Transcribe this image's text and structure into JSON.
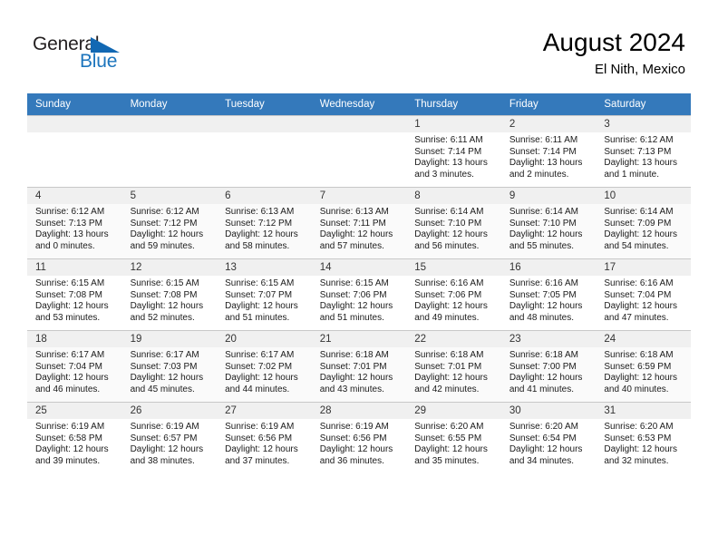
{
  "brand": {
    "line1": "General",
    "line2": "Blue",
    "mark": "triangle-logo"
  },
  "header": {
    "title": "August 2024",
    "subtitle": "El Nith, Mexico"
  },
  "weekdays": [
    "Sunday",
    "Monday",
    "Tuesday",
    "Wednesday",
    "Thursday",
    "Friday",
    "Saturday"
  ],
  "colors": {
    "header_band": "#3479bb",
    "brand_blue": "#1d75bd",
    "daynum_band": "#f0f0f0",
    "row_divider": "#c8c8c8"
  },
  "weeks": [
    [
      {
        "day": "",
        "sunrise": "",
        "sunset": "",
        "daylight1": "",
        "daylight2": ""
      },
      {
        "day": "",
        "sunrise": "",
        "sunset": "",
        "daylight1": "",
        "daylight2": ""
      },
      {
        "day": "",
        "sunrise": "",
        "sunset": "",
        "daylight1": "",
        "daylight2": ""
      },
      {
        "day": "",
        "sunrise": "",
        "sunset": "",
        "daylight1": "",
        "daylight2": ""
      },
      {
        "day": "1",
        "sunrise": "Sunrise: 6:11 AM",
        "sunset": "Sunset: 7:14 PM",
        "daylight1": "Daylight: 13 hours",
        "daylight2": "and 3 minutes."
      },
      {
        "day": "2",
        "sunrise": "Sunrise: 6:11 AM",
        "sunset": "Sunset: 7:14 PM",
        "daylight1": "Daylight: 13 hours",
        "daylight2": "and 2 minutes."
      },
      {
        "day": "3",
        "sunrise": "Sunrise: 6:12 AM",
        "sunset": "Sunset: 7:13 PM",
        "daylight1": "Daylight: 13 hours",
        "daylight2": "and 1 minute."
      }
    ],
    [
      {
        "day": "4",
        "sunrise": "Sunrise: 6:12 AM",
        "sunset": "Sunset: 7:13 PM",
        "daylight1": "Daylight: 13 hours",
        "daylight2": "and 0 minutes."
      },
      {
        "day": "5",
        "sunrise": "Sunrise: 6:12 AM",
        "sunset": "Sunset: 7:12 PM",
        "daylight1": "Daylight: 12 hours",
        "daylight2": "and 59 minutes."
      },
      {
        "day": "6",
        "sunrise": "Sunrise: 6:13 AM",
        "sunset": "Sunset: 7:12 PM",
        "daylight1": "Daylight: 12 hours",
        "daylight2": "and 58 minutes."
      },
      {
        "day": "7",
        "sunrise": "Sunrise: 6:13 AM",
        "sunset": "Sunset: 7:11 PM",
        "daylight1": "Daylight: 12 hours",
        "daylight2": "and 57 minutes."
      },
      {
        "day": "8",
        "sunrise": "Sunrise: 6:14 AM",
        "sunset": "Sunset: 7:10 PM",
        "daylight1": "Daylight: 12 hours",
        "daylight2": "and 56 minutes."
      },
      {
        "day": "9",
        "sunrise": "Sunrise: 6:14 AM",
        "sunset": "Sunset: 7:10 PM",
        "daylight1": "Daylight: 12 hours",
        "daylight2": "and 55 minutes."
      },
      {
        "day": "10",
        "sunrise": "Sunrise: 6:14 AM",
        "sunset": "Sunset: 7:09 PM",
        "daylight1": "Daylight: 12 hours",
        "daylight2": "and 54 minutes."
      }
    ],
    [
      {
        "day": "11",
        "sunrise": "Sunrise: 6:15 AM",
        "sunset": "Sunset: 7:08 PM",
        "daylight1": "Daylight: 12 hours",
        "daylight2": "and 53 minutes."
      },
      {
        "day": "12",
        "sunrise": "Sunrise: 6:15 AM",
        "sunset": "Sunset: 7:08 PM",
        "daylight1": "Daylight: 12 hours",
        "daylight2": "and 52 minutes."
      },
      {
        "day": "13",
        "sunrise": "Sunrise: 6:15 AM",
        "sunset": "Sunset: 7:07 PM",
        "daylight1": "Daylight: 12 hours",
        "daylight2": "and 51 minutes."
      },
      {
        "day": "14",
        "sunrise": "Sunrise: 6:15 AM",
        "sunset": "Sunset: 7:06 PM",
        "daylight1": "Daylight: 12 hours",
        "daylight2": "and 51 minutes."
      },
      {
        "day": "15",
        "sunrise": "Sunrise: 6:16 AM",
        "sunset": "Sunset: 7:06 PM",
        "daylight1": "Daylight: 12 hours",
        "daylight2": "and 49 minutes."
      },
      {
        "day": "16",
        "sunrise": "Sunrise: 6:16 AM",
        "sunset": "Sunset: 7:05 PM",
        "daylight1": "Daylight: 12 hours",
        "daylight2": "and 48 minutes."
      },
      {
        "day": "17",
        "sunrise": "Sunrise: 6:16 AM",
        "sunset": "Sunset: 7:04 PM",
        "daylight1": "Daylight: 12 hours",
        "daylight2": "and 47 minutes."
      }
    ],
    [
      {
        "day": "18",
        "sunrise": "Sunrise: 6:17 AM",
        "sunset": "Sunset: 7:04 PM",
        "daylight1": "Daylight: 12 hours",
        "daylight2": "and 46 minutes."
      },
      {
        "day": "19",
        "sunrise": "Sunrise: 6:17 AM",
        "sunset": "Sunset: 7:03 PM",
        "daylight1": "Daylight: 12 hours",
        "daylight2": "and 45 minutes."
      },
      {
        "day": "20",
        "sunrise": "Sunrise: 6:17 AM",
        "sunset": "Sunset: 7:02 PM",
        "daylight1": "Daylight: 12 hours",
        "daylight2": "and 44 minutes."
      },
      {
        "day": "21",
        "sunrise": "Sunrise: 6:18 AM",
        "sunset": "Sunset: 7:01 PM",
        "daylight1": "Daylight: 12 hours",
        "daylight2": "and 43 minutes."
      },
      {
        "day": "22",
        "sunrise": "Sunrise: 6:18 AM",
        "sunset": "Sunset: 7:01 PM",
        "daylight1": "Daylight: 12 hours",
        "daylight2": "and 42 minutes."
      },
      {
        "day": "23",
        "sunrise": "Sunrise: 6:18 AM",
        "sunset": "Sunset: 7:00 PM",
        "daylight1": "Daylight: 12 hours",
        "daylight2": "and 41 minutes."
      },
      {
        "day": "24",
        "sunrise": "Sunrise: 6:18 AM",
        "sunset": "Sunset: 6:59 PM",
        "daylight1": "Daylight: 12 hours",
        "daylight2": "and 40 minutes."
      }
    ],
    [
      {
        "day": "25",
        "sunrise": "Sunrise: 6:19 AM",
        "sunset": "Sunset: 6:58 PM",
        "daylight1": "Daylight: 12 hours",
        "daylight2": "and 39 minutes."
      },
      {
        "day": "26",
        "sunrise": "Sunrise: 6:19 AM",
        "sunset": "Sunset: 6:57 PM",
        "daylight1": "Daylight: 12 hours",
        "daylight2": "and 38 minutes."
      },
      {
        "day": "27",
        "sunrise": "Sunrise: 6:19 AM",
        "sunset": "Sunset: 6:56 PM",
        "daylight1": "Daylight: 12 hours",
        "daylight2": "and 37 minutes."
      },
      {
        "day": "28",
        "sunrise": "Sunrise: 6:19 AM",
        "sunset": "Sunset: 6:56 PM",
        "daylight1": "Daylight: 12 hours",
        "daylight2": "and 36 minutes."
      },
      {
        "day": "29",
        "sunrise": "Sunrise: 6:20 AM",
        "sunset": "Sunset: 6:55 PM",
        "daylight1": "Daylight: 12 hours",
        "daylight2": "and 35 minutes."
      },
      {
        "day": "30",
        "sunrise": "Sunrise: 6:20 AM",
        "sunset": "Sunset: 6:54 PM",
        "daylight1": "Daylight: 12 hours",
        "daylight2": "and 34 minutes."
      },
      {
        "day": "31",
        "sunrise": "Sunrise: 6:20 AM",
        "sunset": "Sunset: 6:53 PM",
        "daylight1": "Daylight: 12 hours",
        "daylight2": "and 32 minutes."
      }
    ]
  ]
}
